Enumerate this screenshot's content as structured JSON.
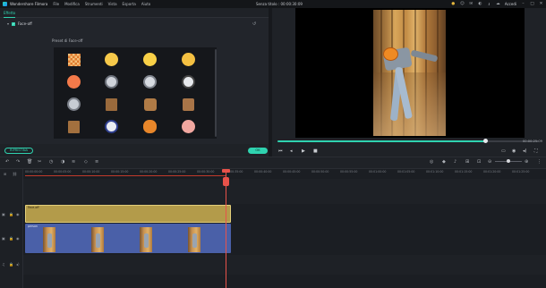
{
  "titlebar": {
    "app_name": "Wondershare Filmora",
    "menus": [
      "File",
      "Modifica",
      "Strumenti",
      "Vista",
      "Esporta",
      "Aiuto"
    ],
    "project_title": "Senza titolo : 00:00:30:09",
    "login_label": "Accedi"
  },
  "effect_panel": {
    "tab_label": "Effetto",
    "section_label": "Face-off",
    "preset_label": "Preset di Face-off",
    "reset_label": "RIPRISTINA",
    "ok_label": "OK",
    "presets": [
      "checker-face",
      "smirk-emoji",
      "grin-emoji",
      "sad-emoji",
      "angry-emoji",
      "cat-mask",
      "tiger-mask",
      "panda-mask",
      "lion-mask",
      "box-face",
      "bear-mask",
      "pig-mask",
      "box-face-2",
      "ninja-mask",
      "pumpkin-face",
      "pig-face"
    ]
  },
  "preview": {
    "timecode": "00:00:25:09",
    "quality": "1/2"
  },
  "timeline": {
    "ruler_ticks": [
      "00:00:00:00",
      "00:00:05:00",
      "00:00:10:00",
      "00:00:15:00",
      "00:00:20:00",
      "00:00:25:00",
      "00:00:30:00",
      "00:00:35:00",
      "00:00:40:00",
      "00:00:45:00",
      "00:00:50:00",
      "00:00:55:00",
      "00:01:00:00",
      "00:01:05:00",
      "00:01:10:00",
      "00:01:15:00",
      "00:01:20:00",
      "00:01:25:00",
      "00:01:30:00"
    ],
    "clips": {
      "effect_clip": "Face-off",
      "video_clip": "person"
    }
  },
  "colors": {
    "accent": "#2fd3b0",
    "playhead": "#e8524a",
    "effect_clip": "#b39b4a",
    "video_clip": "#4a60a8"
  }
}
